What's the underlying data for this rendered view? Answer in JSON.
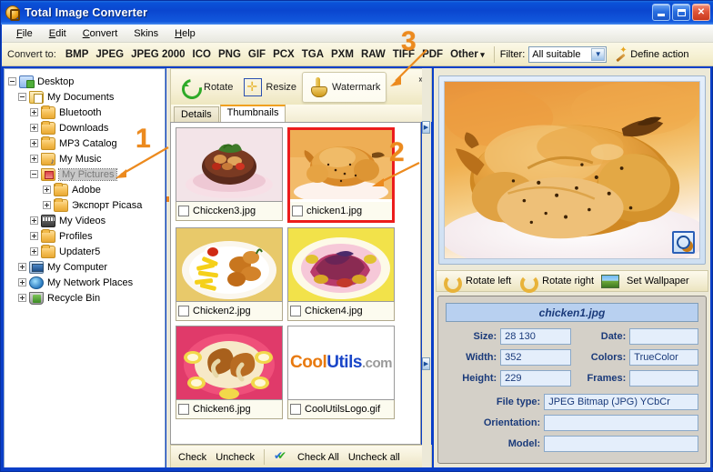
{
  "window": {
    "title": "Total Image Converter",
    "icon": "app-logo-icon",
    "minimize": "—",
    "maximize": "□",
    "close": "✕"
  },
  "menu": {
    "items": [
      "File",
      "Edit",
      "Convert",
      "Skins",
      "Help"
    ]
  },
  "convert_bar": {
    "label": "Convert to:",
    "formats": [
      "BMP",
      "JPEG",
      "JPEG 2000",
      "ICO",
      "PNG",
      "GIF",
      "PCX",
      "TGA",
      "PXM",
      "RAW",
      "TIFF",
      "PDF"
    ],
    "other_label": "Other",
    "filter_label": "Filter:",
    "filter_value": "All suitable",
    "filter_arrow": "▼",
    "define_action_label": "Define action",
    "define_action_icon": "magic-wand-icon"
  },
  "tree": {
    "nodes": [
      {
        "label": "Desktop",
        "indent": 0,
        "expander": "minus",
        "icon": "desktop-icon",
        "selected": false
      },
      {
        "label": "My Documents",
        "indent": 1,
        "expander": "minus",
        "icon": "documents-folder-icon",
        "selected": false
      },
      {
        "label": "Bluetooth",
        "indent": 2,
        "expander": "plus",
        "icon": "folder-icon",
        "selected": false
      },
      {
        "label": "Downloads",
        "indent": 2,
        "expander": "plus",
        "icon": "folder-icon",
        "selected": false
      },
      {
        "label": "MP3 Catalog",
        "indent": 2,
        "expander": "plus",
        "icon": "folder-icon",
        "selected": false
      },
      {
        "label": "My Music",
        "indent": 2,
        "expander": "plus",
        "icon": "music-folder-icon",
        "selected": false
      },
      {
        "label": "My Pictures",
        "indent": 2,
        "expander": "minus",
        "icon": "pictures-folder-icon",
        "selected": true
      },
      {
        "label": "Adobe",
        "indent": 3,
        "expander": "plus",
        "icon": "folder-icon",
        "selected": false
      },
      {
        "label": "Экспорт Picasa",
        "indent": 3,
        "expander": "plus",
        "icon": "folder-icon",
        "selected": false
      },
      {
        "label": "My Videos",
        "indent": 2,
        "expander": "plus",
        "icon": "video-folder-icon",
        "selected": false
      },
      {
        "label": "Profiles",
        "indent": 2,
        "expander": "plus",
        "icon": "folder-icon",
        "selected": false
      },
      {
        "label": "Updater5",
        "indent": 2,
        "expander": "plus",
        "icon": "folder-icon",
        "selected": false
      },
      {
        "label": "My Computer",
        "indent": 1,
        "expander": "plus",
        "icon": "computer-icon",
        "selected": false
      },
      {
        "label": "My Network Places",
        "indent": 1,
        "expander": "plus",
        "icon": "network-icon",
        "selected": false
      },
      {
        "label": "Recycle Bin",
        "indent": 1,
        "expander": "plus",
        "icon": "recycle-bin-icon",
        "selected": false
      }
    ]
  },
  "tools": {
    "rotate": "Rotate",
    "resize": "Resize",
    "watermark": "Watermark",
    "overflow": "»"
  },
  "view_tabs": {
    "details": "Details",
    "thumbnails": "Thumbnails",
    "active": "Thumbnails"
  },
  "thumbnails": [
    {
      "name": "Chiccken3.jpg",
      "checked": false,
      "selected": false,
      "art": "salad-bowl"
    },
    {
      "name": "chicken1.jpg",
      "checked": false,
      "selected": true,
      "art": "roast-chicken"
    },
    {
      "name": "Chicken2.jpg",
      "checked": false,
      "selected": false,
      "art": "nuggets-fries"
    },
    {
      "name": "Chicken4.jpg",
      "checked": false,
      "selected": false,
      "art": "grilled-chicken"
    },
    {
      "name": "Chicken6.jpg",
      "checked": false,
      "selected": false,
      "art": "drumsticks-rice"
    },
    {
      "name": "CoolUtilsLogo.gif",
      "checked": false,
      "selected": false,
      "art": "coolutils-logo"
    }
  ],
  "logo": {
    "cool": "Cool",
    "utils": "Utils",
    "com": ".com"
  },
  "check_bar": {
    "check": "Check",
    "uncheck": "Uncheck",
    "check_all": "Check All",
    "uncheck_all": "Uncheck all",
    "check_all_icon": "double-check-icon"
  },
  "preview": {
    "zoom_icon": "zoom-magnifier-icon"
  },
  "rotate_bar": {
    "rotate_left": "Rotate left",
    "rotate_right": "Rotate right",
    "set_wallpaper": "Set Wallpaper",
    "rotate_left_icon": "rotate-left-icon",
    "rotate_right_icon": "rotate-right-icon",
    "wallpaper_icon": "wallpaper-icon"
  },
  "properties": {
    "title": "chicken1.jpg",
    "size_label": "Size:",
    "size_value": "28 130",
    "date_label": "Date:",
    "date_value": "",
    "width_label": "Width:",
    "width_value": "352",
    "colors_label": "Colors:",
    "colors_value": "TrueColor",
    "height_label": "Height:",
    "height_value": "229",
    "frames_label": "Frames:",
    "frames_value": "",
    "filetype_label": "File type:",
    "filetype_value": "JPEG Bitmap (JPG) YCbCr",
    "orientation_label": "Orientation:",
    "orientation_value": "",
    "model_label": "Model:",
    "model_value": ""
  },
  "annotations": [
    {
      "number": "1",
      "target": "my-pictures-tree-node"
    },
    {
      "number": "2",
      "target": "selected-thumbnail"
    },
    {
      "number": "3",
      "target": "watermark-tool"
    }
  ],
  "colors": {
    "titlebar": "#0a46cf",
    "annotation": "#ec8a1e",
    "selection": "#ec1c1c",
    "accent_tab": "#f0a020"
  }
}
